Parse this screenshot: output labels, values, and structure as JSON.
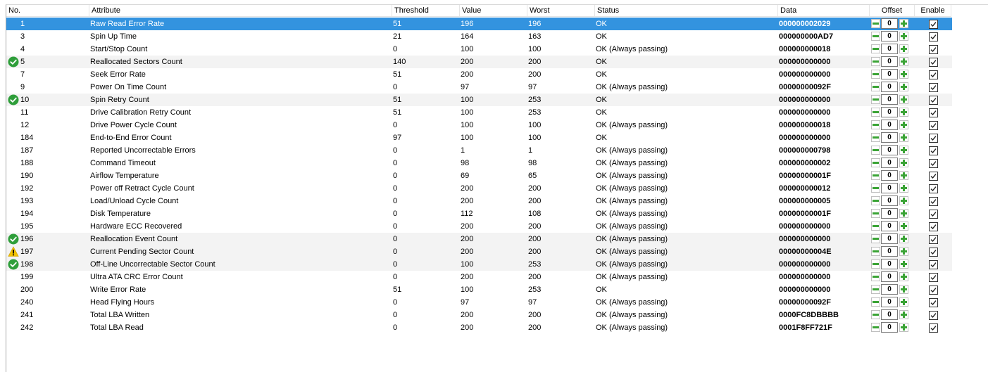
{
  "columns": {
    "no": "No.",
    "attribute": "Attribute",
    "threshold": "Threshold",
    "value": "Value",
    "worst": "Worst",
    "status": "Status",
    "data": "Data",
    "offset": "Offset",
    "enable": "Enable"
  },
  "colors": {
    "selected_row": "#3393df",
    "ok_icon": "#2e9e3a",
    "warn_icon": "#f2c200",
    "offset_button": "#3aa335"
  },
  "rows": [
    {
      "no": "1",
      "attribute": "Raw Read Error Rate",
      "threshold": "51",
      "value": "196",
      "worst": "196",
      "status": "OK",
      "data": "000000002029",
      "offset": "0",
      "enabled": true,
      "icon": "",
      "selected": true
    },
    {
      "no": "3",
      "attribute": "Spin Up Time",
      "threshold": "21",
      "value": "164",
      "worst": "163",
      "status": "OK",
      "data": "000000000AD7",
      "offset": "0",
      "enabled": true,
      "icon": ""
    },
    {
      "no": "4",
      "attribute": "Start/Stop Count",
      "threshold": "0",
      "value": "100",
      "worst": "100",
      "status": "OK (Always passing)",
      "data": "000000000018",
      "offset": "0",
      "enabled": true,
      "icon": ""
    },
    {
      "no": "5",
      "attribute": "Reallocated Sectors Count",
      "threshold": "140",
      "value": "200",
      "worst": "200",
      "status": "OK",
      "data": "000000000000",
      "offset": "0",
      "enabled": true,
      "icon": "check-circle-icon"
    },
    {
      "no": "7",
      "attribute": "Seek Error Rate",
      "threshold": "51",
      "value": "200",
      "worst": "200",
      "status": "OK",
      "data": "000000000000",
      "offset": "0",
      "enabled": true,
      "icon": ""
    },
    {
      "no": "9",
      "attribute": "Power On Time Count",
      "threshold": "0",
      "value": "97",
      "worst": "97",
      "status": "OK (Always passing)",
      "data": "00000000092F",
      "offset": "0",
      "enabled": true,
      "icon": ""
    },
    {
      "no": "10",
      "attribute": "Spin Retry Count",
      "threshold": "51",
      "value": "100",
      "worst": "253",
      "status": "OK",
      "data": "000000000000",
      "offset": "0",
      "enabled": true,
      "icon": "check-circle-icon"
    },
    {
      "no": "11",
      "attribute": "Drive Calibration Retry Count",
      "threshold": "51",
      "value": "100",
      "worst": "253",
      "status": "OK",
      "data": "000000000000",
      "offset": "0",
      "enabled": true,
      "icon": ""
    },
    {
      "no": "12",
      "attribute": "Drive Power Cycle Count",
      "threshold": "0",
      "value": "100",
      "worst": "100",
      "status": "OK (Always passing)",
      "data": "000000000018",
      "offset": "0",
      "enabled": true,
      "icon": ""
    },
    {
      "no": "184",
      "attribute": "End-to-End Error Count",
      "threshold": "97",
      "value": "100",
      "worst": "100",
      "status": "OK",
      "data": "000000000000",
      "offset": "0",
      "enabled": true,
      "icon": ""
    },
    {
      "no": "187",
      "attribute": "Reported Uncorrectable Errors",
      "threshold": "0",
      "value": "1",
      "worst": "1",
      "status": "OK (Always passing)",
      "data": "000000000798",
      "offset": "0",
      "enabled": true,
      "icon": ""
    },
    {
      "no": "188",
      "attribute": "Command Timeout",
      "threshold": "0",
      "value": "98",
      "worst": "98",
      "status": "OK (Always passing)",
      "data": "000000000002",
      "offset": "0",
      "enabled": true,
      "icon": ""
    },
    {
      "no": "190",
      "attribute": "Airflow Temperature",
      "threshold": "0",
      "value": "69",
      "worst": "65",
      "status": "OK (Always passing)",
      "data": "00000000001F",
      "offset": "0",
      "enabled": true,
      "icon": ""
    },
    {
      "no": "192",
      "attribute": "Power off Retract Cycle Count",
      "threshold": "0",
      "value": "200",
      "worst": "200",
      "status": "OK (Always passing)",
      "data": "000000000012",
      "offset": "0",
      "enabled": true,
      "icon": ""
    },
    {
      "no": "193",
      "attribute": "Load/Unload Cycle Count",
      "threshold": "0",
      "value": "200",
      "worst": "200",
      "status": "OK (Always passing)",
      "data": "000000000005",
      "offset": "0",
      "enabled": true,
      "icon": ""
    },
    {
      "no": "194",
      "attribute": "Disk Temperature",
      "threshold": "0",
      "value": "112",
      "worst": "108",
      "status": "OK (Always passing)",
      "data": "00000000001F",
      "offset": "0",
      "enabled": true,
      "icon": ""
    },
    {
      "no": "195",
      "attribute": "Hardware ECC Recovered",
      "threshold": "0",
      "value": "200",
      "worst": "200",
      "status": "OK (Always passing)",
      "data": "000000000000",
      "offset": "0",
      "enabled": true,
      "icon": ""
    },
    {
      "no": "196",
      "attribute": "Reallocation Event Count",
      "threshold": "0",
      "value": "200",
      "worst": "200",
      "status": "OK (Always passing)",
      "data": "000000000000",
      "offset": "0",
      "enabled": true,
      "icon": "check-circle-icon"
    },
    {
      "no": "197",
      "attribute": "Current Pending Sector Count",
      "threshold": "0",
      "value": "200",
      "worst": "200",
      "status": "OK (Always passing)",
      "data": "00000000004E",
      "offset": "0",
      "enabled": true,
      "icon": "warning-icon"
    },
    {
      "no": "198",
      "attribute": "Off-Line Uncorrectable Sector Count",
      "threshold": "0",
      "value": "100",
      "worst": "253",
      "status": "OK (Always passing)",
      "data": "000000000000",
      "offset": "0",
      "enabled": true,
      "icon": "check-circle-icon"
    },
    {
      "no": "199",
      "attribute": "Ultra ATA CRC Error Count",
      "threshold": "0",
      "value": "200",
      "worst": "200",
      "status": "OK (Always passing)",
      "data": "000000000000",
      "offset": "0",
      "enabled": true,
      "icon": ""
    },
    {
      "no": "200",
      "attribute": "Write Error Rate",
      "threshold": "51",
      "value": "100",
      "worst": "253",
      "status": "OK",
      "data": "000000000000",
      "offset": "0",
      "enabled": true,
      "icon": ""
    },
    {
      "no": "240",
      "attribute": "Head Flying Hours",
      "threshold": "0",
      "value": "97",
      "worst": "97",
      "status": "OK (Always passing)",
      "data": "00000000092F",
      "offset": "0",
      "enabled": true,
      "icon": ""
    },
    {
      "no": "241",
      "attribute": "Total LBA Written",
      "threshold": "0",
      "value": "200",
      "worst": "200",
      "status": "OK (Always passing)",
      "data": "0000FC8DBBBB",
      "offset": "0",
      "enabled": true,
      "icon": ""
    },
    {
      "no": "242",
      "attribute": "Total LBA Read",
      "threshold": "0",
      "value": "200",
      "worst": "200",
      "status": "OK (Always passing)",
      "data": "0001F8FF721F",
      "offset": "0",
      "enabled": true,
      "icon": ""
    }
  ]
}
